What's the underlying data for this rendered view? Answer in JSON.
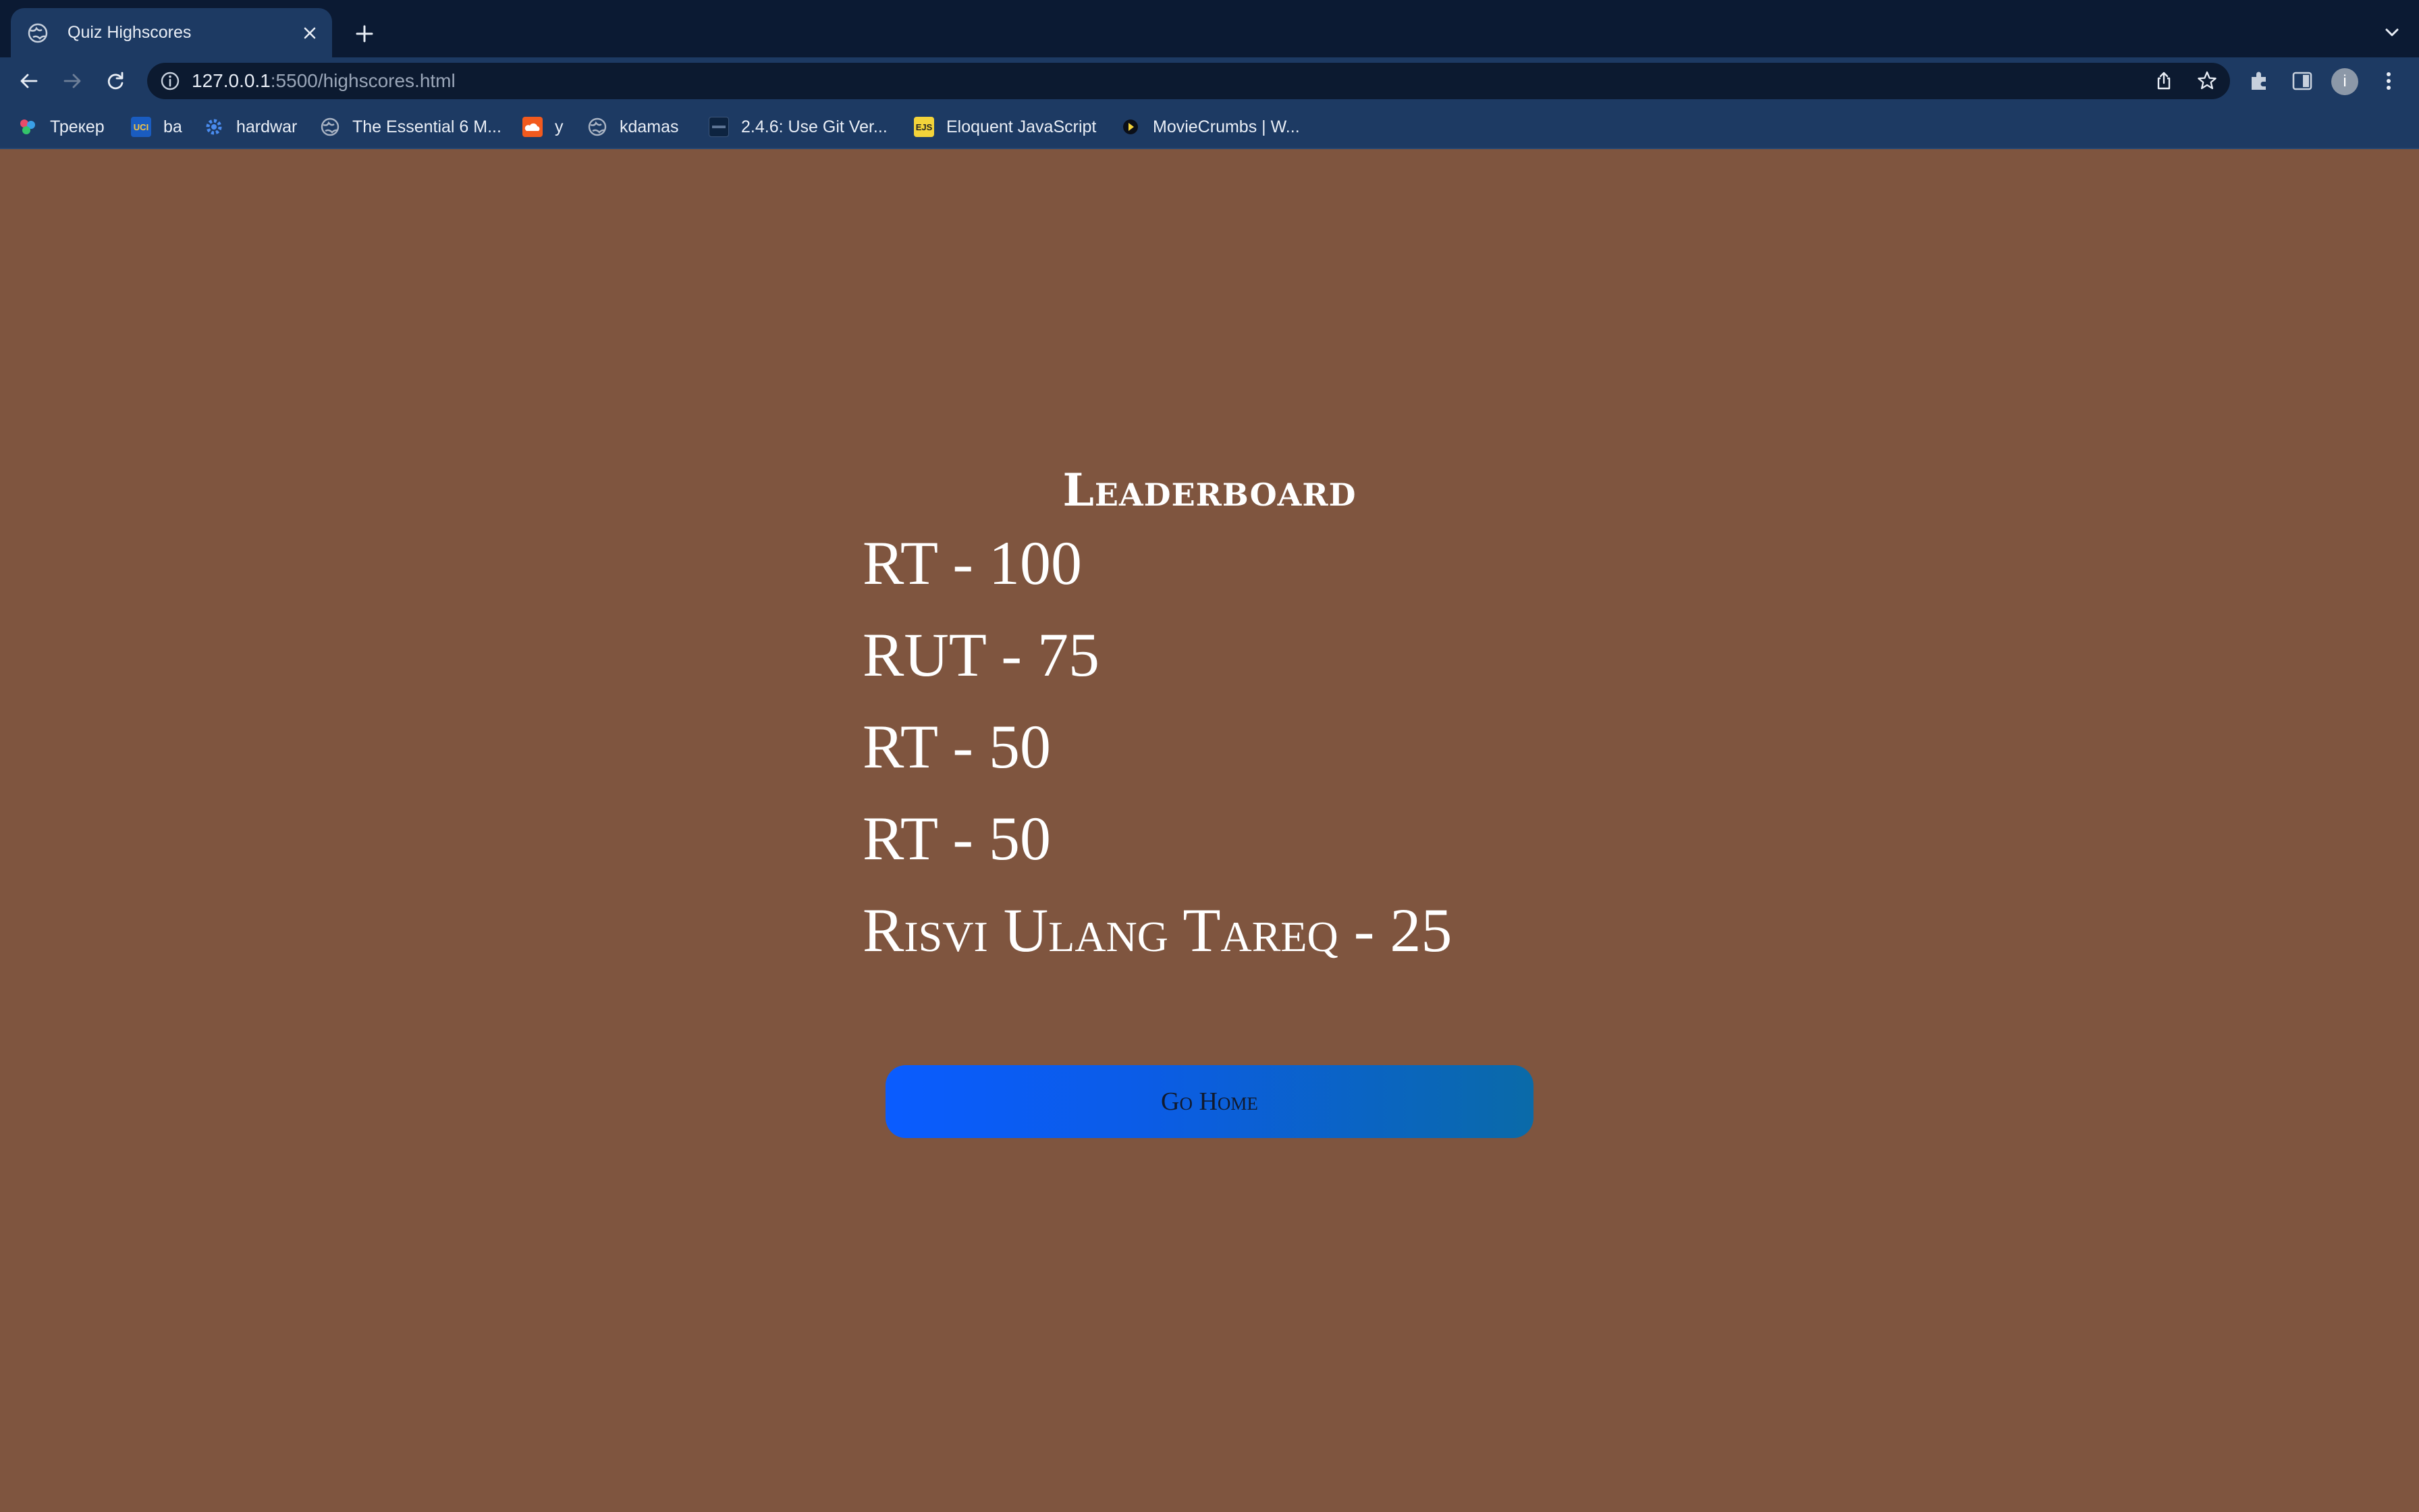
{
  "browser": {
    "tab": {
      "title": "Quiz Highscores"
    },
    "url": {
      "host": "127.0.0.1",
      "rest": ":5500/highscores.html"
    },
    "profile_initial": "i",
    "bookmarks": [
      {
        "label": "Трекер",
        "icon": "tracker-icon"
      },
      {
        "label": "ba",
        "icon": "uci-icon",
        "badge": "UCI"
      },
      {
        "label": "hardwar",
        "icon": "gear-icon"
      },
      {
        "label": "The Essential 6 M...",
        "icon": "globe-icon"
      },
      {
        "label": "y",
        "icon": "soundcloud-icon"
      },
      {
        "label": "kdamas",
        "icon": "globe-icon"
      },
      {
        "label": "2.4.6: Use Git Ver...",
        "icon": "site-icon"
      },
      {
        "label": "Eloquent JavaScript",
        "icon": "ejs-icon",
        "badge": "EJS"
      },
      {
        "label": "MovieCrumbs | W...",
        "icon": "play-icon"
      }
    ]
  },
  "leaderboard": {
    "title": "Leaderboard",
    "scores": [
      "RT - 100",
      "RUT - 75",
      "RT - 50",
      "RT - 50",
      "Risvi Ulang Tareq - 25"
    ]
  },
  "actions": {
    "go_home_label": "Go Home"
  },
  "colors": {
    "page_background": "#7f553f",
    "button_gradient_start": "#0a5cff",
    "button_gradient_end": "#0a6aa8",
    "chrome_dark": "#0b1a33",
    "chrome_toolbar": "#1d3a63"
  }
}
